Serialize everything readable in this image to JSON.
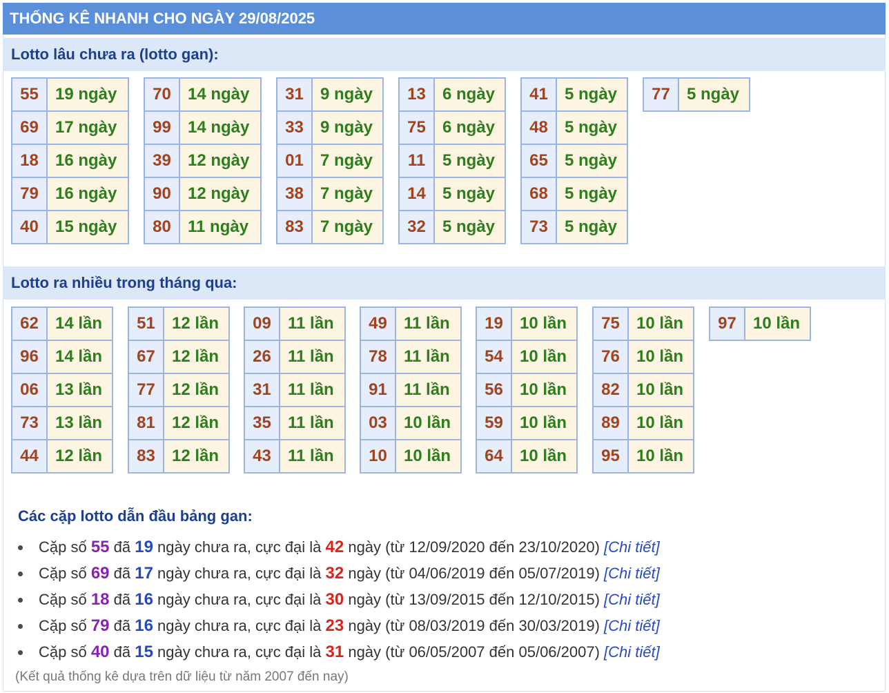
{
  "title": "THỐNG KÊ NHANH CHO NGÀY 29/08/2025",
  "gan": {
    "heading": "Lotto lâu chưa ra (lotto gan):",
    "groups": [
      [
        [
          "55",
          "19 ngày"
        ],
        [
          "69",
          "17 ngày"
        ],
        [
          "18",
          "16 ngày"
        ],
        [
          "79",
          "16 ngày"
        ],
        [
          "40",
          "15 ngày"
        ]
      ],
      [
        [
          "70",
          "14 ngày"
        ],
        [
          "99",
          "14 ngày"
        ],
        [
          "39",
          "12 ngày"
        ],
        [
          "90",
          "12 ngày"
        ],
        [
          "80",
          "11 ngày"
        ]
      ],
      [
        [
          "31",
          "9 ngày"
        ],
        [
          "33",
          "9 ngày"
        ],
        [
          "01",
          "7 ngày"
        ],
        [
          "38",
          "7 ngày"
        ],
        [
          "83",
          "7 ngày"
        ]
      ],
      [
        [
          "13",
          "6 ngày"
        ],
        [
          "75",
          "6 ngày"
        ],
        [
          "11",
          "5 ngày"
        ],
        [
          "14",
          "5 ngày"
        ],
        [
          "32",
          "5 ngày"
        ]
      ],
      [
        [
          "41",
          "5 ngày"
        ],
        [
          "48",
          "5 ngày"
        ],
        [
          "65",
          "5 ngày"
        ],
        [
          "68",
          "5 ngày"
        ],
        [
          "73",
          "5 ngày"
        ]
      ],
      [
        [
          "77",
          "5 ngày"
        ]
      ]
    ]
  },
  "frequent": {
    "heading": "Lotto ra nhiều trong tháng qua:",
    "groups": [
      [
        [
          "62",
          "14 lần"
        ],
        [
          "96",
          "14 lần"
        ],
        [
          "06",
          "13 lần"
        ],
        [
          "73",
          "13 lần"
        ],
        [
          "44",
          "12 lần"
        ]
      ],
      [
        [
          "51",
          "12 lần"
        ],
        [
          "67",
          "12 lần"
        ],
        [
          "77",
          "12 lần"
        ],
        [
          "81",
          "12 lần"
        ],
        [
          "83",
          "12 lần"
        ]
      ],
      [
        [
          "09",
          "11 lần"
        ],
        [
          "26",
          "11 lần"
        ],
        [
          "31",
          "11 lần"
        ],
        [
          "35",
          "11 lần"
        ],
        [
          "43",
          "11 lần"
        ]
      ],
      [
        [
          "49",
          "11 lần"
        ],
        [
          "78",
          "11 lần"
        ],
        [
          "91",
          "11 lần"
        ],
        [
          "03",
          "10 lần"
        ],
        [
          "10",
          "10 lần"
        ]
      ],
      [
        [
          "19",
          "10 lần"
        ],
        [
          "54",
          "10 lần"
        ],
        [
          "56",
          "10 lần"
        ],
        [
          "59",
          "10 lần"
        ],
        [
          "64",
          "10 lần"
        ]
      ],
      [
        [
          "75",
          "10 lần"
        ],
        [
          "76",
          "10 lần"
        ],
        [
          "82",
          "10 lần"
        ],
        [
          "89",
          "10 lần"
        ],
        [
          "95",
          "10 lần"
        ]
      ],
      [
        [
          "97",
          "10 lần"
        ]
      ]
    ]
  },
  "summary": {
    "heading": "Các cặp lotto dẫn đầu bảng gan:",
    "text": {
      "prefix": "Cặp số",
      "mid1": "đã",
      "mid2": "ngày chưa ra, cực đại là",
      "mid3": "ngày (từ",
      "mid4": "đến",
      "link": "[Chi tiết]"
    },
    "items": [
      {
        "pair": "55",
        "days": "19",
        "max": "42",
        "from": "12/09/2020",
        "to": "23/10/2020"
      },
      {
        "pair": "69",
        "days": "17",
        "max": "32",
        "from": "04/06/2019",
        "to": "05/07/2019"
      },
      {
        "pair": "18",
        "days": "16",
        "max": "30",
        "from": "13/09/2015",
        "to": "12/10/2015"
      },
      {
        "pair": "79",
        "days": "16",
        "max": "23",
        "from": "08/03/2019",
        "to": "30/03/2019"
      },
      {
        "pair": "40",
        "days": "15",
        "max": "31",
        "from": "06/05/2007",
        "to": "05/06/2007"
      }
    ]
  },
  "footnote": "(Kết quả thống kê dựa trên dữ liệu từ năm 2007 đến nay)"
}
